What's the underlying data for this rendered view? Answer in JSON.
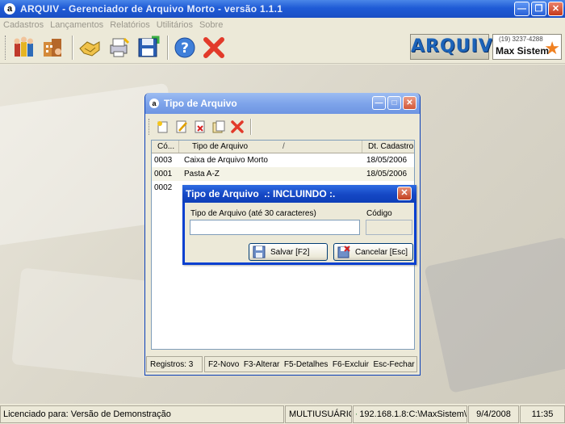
{
  "window": {
    "title": "ARQUIV - Gerenciador de Arquivo Morto - versão 1.1.1",
    "app_icon_letter": "a"
  },
  "menu": [
    "Cadastros",
    "Lançamentos",
    "Relatórios",
    "Utilitários",
    "Sobre"
  ],
  "toolbar": {
    "icons": [
      "people-icon",
      "building-icon",
      "handshake-icon",
      "printer-icon",
      "save-disk-icon",
      "help-icon",
      "close-x-icon"
    ]
  },
  "branding": {
    "arquiv_logo": "ARQUIV",
    "max_phone": "(19) 3237-4288",
    "max_name": "Max Sistem"
  },
  "child_window": {
    "title": "Tipo de Arquivo",
    "columns": [
      "Có...",
      "Tipo de Arquivo",
      "Dt. Cadastro"
    ],
    "sort_marker": "/",
    "rows": [
      {
        "codigo": "0003",
        "tipo": "Caixa de Arquivo Morto",
        "data": "18/05/2006"
      },
      {
        "codigo": "0001",
        "tipo": "Pasta A-Z",
        "data": "18/05/2006"
      },
      {
        "codigo": "0002",
        "tipo": "",
        "data": ""
      }
    ],
    "status": {
      "registros": "Registros: 3",
      "shortcuts": "F2-Novo  F3-Alterar  F5-Detalhes  F6-Excluir  Esc-Fechar"
    }
  },
  "dialog": {
    "title": "Tipo de Arquivo  .: INCLUINDO :.",
    "label_tipo": "Tipo de Arquivo (até 30 caracteres)",
    "label_codigo": "Código",
    "tipo_value": "",
    "codigo_value": "",
    "save_label": "Salvar [F2]",
    "cancel_label": "Cancelar [Esc]"
  },
  "statusbar": {
    "license": "Licenciado para: Versão de Demonstração",
    "mode": "MULTIUSUÁRIO",
    "path": "192.168.1.8:C:\\MaxSistem\\",
    "date": "9/4/2008",
    "time": "11:35"
  }
}
